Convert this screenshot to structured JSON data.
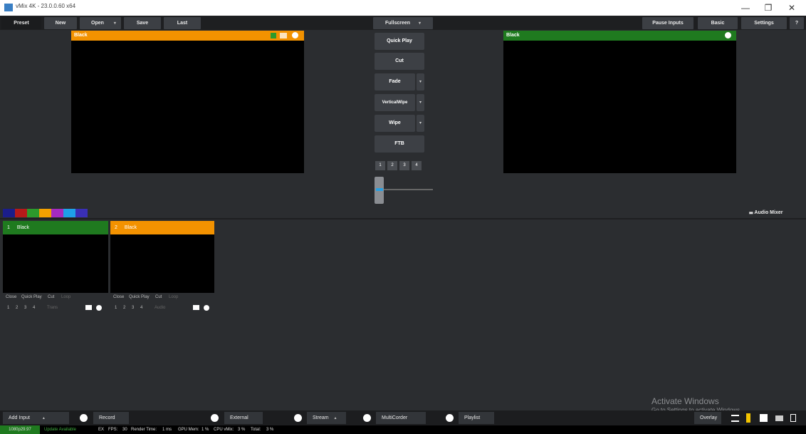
{
  "window": {
    "title": "vMix 4K - 23.0.0.60 x64",
    "minimize": "—",
    "maximize": "❐",
    "close": "✕"
  },
  "toolbar": {
    "preset": "Preset",
    "new": "New",
    "open": "Open",
    "save": "Save",
    "last": "Last",
    "fullscreen": "Fullscreen",
    "pause_inputs": "Pause Inputs",
    "basic": "Basic",
    "settings": "Settings",
    "help": "?"
  },
  "preview": {
    "title": "Black"
  },
  "output": {
    "title": "Black"
  },
  "transitions": {
    "quick_play": "Quick Play",
    "cut": "Cut",
    "fade": "Fade",
    "merge": "VerticalWipe",
    "wipe": "Wipe",
    "ftb": "FTB",
    "numbers": [
      "1",
      "2",
      "3",
      "4"
    ],
    "tbar_position": 0
  },
  "colors": {
    "preview_accent": "#f39200",
    "output_accent": "#1f7a1f",
    "swatches": [
      "#1b1d8a",
      "#b51a1a",
      "#2c9a2c",
      "#f3a000",
      "#a52abf",
      "#1ea0e8",
      "#3a2fb5"
    ]
  },
  "audio_mixer": {
    "label": "Audio Mixer",
    "icon": "mixer-icon"
  },
  "inputs": [
    {
      "number": "1",
      "name": "Black",
      "controls": [
        "Close",
        "Quick Play",
        "Cut",
        "Loop"
      ],
      "overlays": [
        "1",
        "2",
        "3",
        "4"
      ],
      "extra": "Trans",
      "color": "#1f7a1f"
    },
    {
      "number": "2",
      "name": "Black",
      "controls": [
        "Close",
        "Quick Play",
        "Cut",
        "Loop"
      ],
      "overlays": [
        "1",
        "2",
        "3",
        "4"
      ],
      "extra": "Audio",
      "color": "#f39200"
    }
  ],
  "bottom": {
    "add_input": "Add Input",
    "record": "Record",
    "external": "External",
    "stream": "Stream",
    "multicorder": "MultiCorder",
    "playlist": "Playlist",
    "overlay": "Overlay"
  },
  "watermark": {
    "line1": "Activate Windows",
    "line2": "Go to Settings to activate Windows."
  },
  "status": {
    "resolution": "1080p29.97",
    "update": "Update Available",
    "ex": "EX",
    "fps_label": "FPS:",
    "fps_value": "30",
    "render_label": "Render Time:",
    "render_value": "1 ms",
    "gpu_label": "GPU Mem:",
    "gpu_value": "1 %",
    "cpu_label": "CPU vMix:",
    "cpu_value": "3 %",
    "total_label": "Total:",
    "total_value": "3 %"
  }
}
